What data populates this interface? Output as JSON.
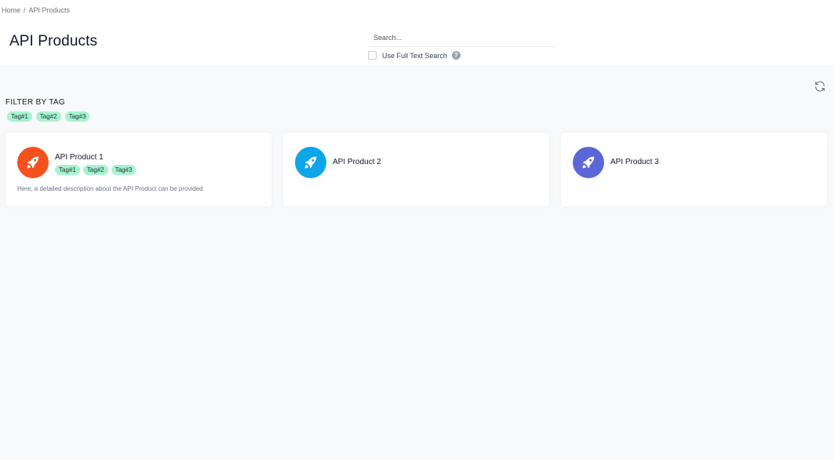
{
  "breadcrumb": {
    "home": "Home",
    "separator": "/",
    "current": "API Products"
  },
  "page": {
    "title": "API Products"
  },
  "search": {
    "placeholder": "Search...",
    "full_text_label": "Use Full Text Search",
    "help": "?"
  },
  "filter": {
    "title": "FILTER BY TAG",
    "tags": [
      "Tag#1",
      "Tag#2",
      "Tag#3"
    ]
  },
  "products": [
    {
      "title": "API Product 1",
      "tags": [
        "Tag#1",
        "Tag#2",
        "Tag#3"
      ],
      "description": "Here, a detailed description about the API Product can be provided",
      "color": "#f4511e",
      "icon": "rocket-icon"
    },
    {
      "title": "API Product 2",
      "color": "#0ea5e9",
      "icon": "rocket-icon"
    },
    {
      "title": "API Product 3",
      "color": "#5b67d8",
      "icon": "rocket-icon"
    }
  ],
  "colors": {
    "tag_bg": "#a7f3d0",
    "page_bg": "#f8f9fb"
  }
}
